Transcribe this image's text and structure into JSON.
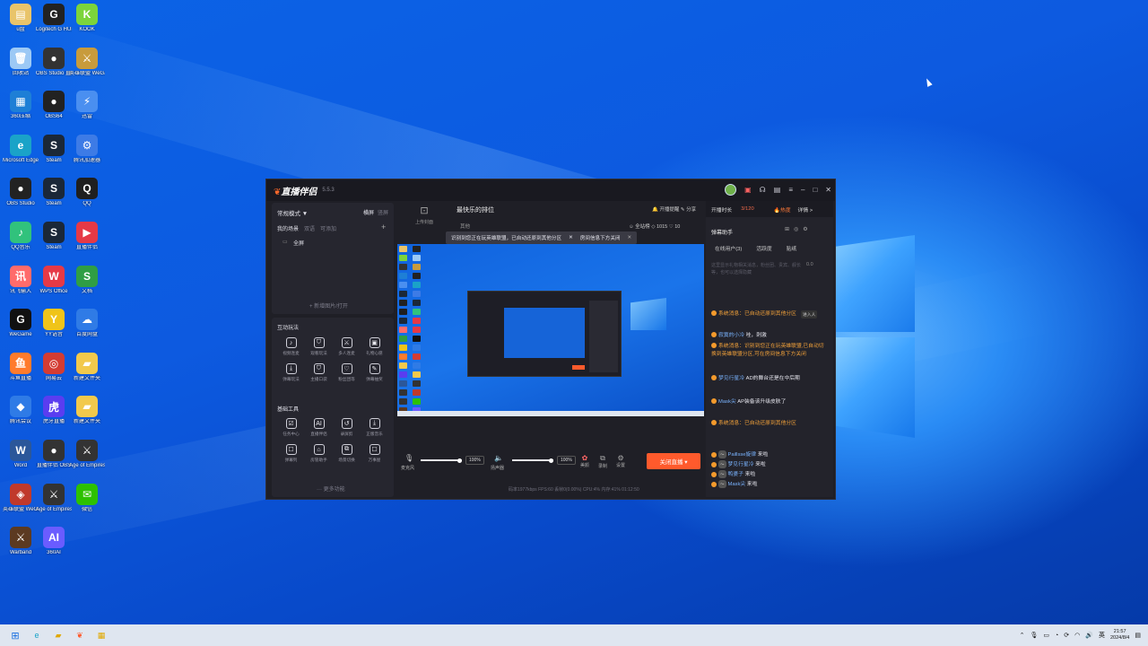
{
  "desktop_icons": [
    {
      "label": "u盘",
      "color": "#e9c46a",
      "glyph": "▤"
    },
    {
      "label": "Logitech G HUB",
      "color": "#222",
      "glyph": "G"
    },
    {
      "label": "KOOK",
      "color": "#7cd43b",
      "glyph": "K"
    },
    {
      "label": "回收站",
      "color": "#9cc9f5",
      "glyph": "🗑"
    },
    {
      "label": "OBS Studio 直播伴侣",
      "color": "#333",
      "glyph": "●"
    },
    {
      "label": "英雄联盟 WeGame版",
      "color": "#c89b3c",
      "glyph": "⚔"
    },
    {
      "label": "360压缩",
      "color": "#1e7fd6",
      "glyph": "▦"
    },
    {
      "label": "OBS64",
      "color": "#222",
      "glyph": "●"
    },
    {
      "label": "迅雷",
      "color": "#4a8ff0",
      "glyph": "⚡"
    },
    {
      "label": "Microsoft Edge",
      "color": "#1aa3c8",
      "glyph": "e"
    },
    {
      "label": "Steam",
      "color": "#1b2838",
      "glyph": "S"
    },
    {
      "label": "腾讯加速器",
      "color": "#3d7be6",
      "glyph": "⚙"
    },
    {
      "label": "OBS Studio",
      "color": "#222",
      "glyph": "●"
    },
    {
      "label": "Steam",
      "color": "#1b2838",
      "glyph": "S"
    },
    {
      "label": "QQ",
      "color": "#1f1f1f",
      "glyph": "Q"
    },
    {
      "label": "QQ音乐",
      "color": "#31c27c",
      "glyph": "♪"
    },
    {
      "label": "Steam",
      "color": "#1b2838",
      "glyph": "S"
    },
    {
      "label": "直播伴侣",
      "color": "#e63946",
      "glyph": "▶"
    },
    {
      "label": "讯飞输入",
      "color": "#ff6b6b",
      "glyph": "讯"
    },
    {
      "label": "WPS Office",
      "color": "#e63946",
      "glyph": "W"
    },
    {
      "label": "文档",
      "color": "#2f9e44",
      "glyph": "S"
    },
    {
      "label": "WeGame",
      "color": "#111",
      "glyph": "G"
    },
    {
      "label": "YY语音",
      "color": "#f0c419",
      "glyph": "Y"
    },
    {
      "label": "百度网盘",
      "color": "#2f7be6",
      "glyph": "☁"
    },
    {
      "label": "斗鱼直播",
      "color": "#ff7b2c",
      "glyph": "鱼"
    },
    {
      "label": "网易云",
      "color": "#d43c33",
      "glyph": "◎"
    },
    {
      "label": "新建文件夹",
      "color": "#f2c94c",
      "glyph": "▰"
    },
    {
      "label": "腾讯会议",
      "color": "#2f7be6",
      "glyph": "◆"
    },
    {
      "label": "虎牙直播",
      "color": "#5a3df0",
      "glyph": "虎"
    },
    {
      "label": "新建文件夹",
      "color": "#f2c94c",
      "glyph": "▰"
    },
    {
      "label": "Word",
      "color": "#2b579a",
      "glyph": "W"
    },
    {
      "label": "直播伴侣 OBS",
      "color": "#333",
      "glyph": "●"
    },
    {
      "label": "Age of Empires",
      "color": "#333",
      "glyph": "⚔"
    },
    {
      "label": "英雄联盟 WeGame版",
      "color": "#c0392b",
      "glyph": "◈"
    },
    {
      "label": "Age of Empires",
      "color": "#333",
      "glyph": "⚔"
    },
    {
      "label": "微信",
      "color": "#2dc100",
      "glyph": "✉"
    },
    {
      "label": "Warband",
      "color": "#5c3a21",
      "glyph": "⚔"
    },
    {
      "label": "360AI",
      "color": "#6a5cff",
      "glyph": "AI"
    }
  ],
  "app": {
    "logo_brand": "直播伴侣",
    "version": "5.5.3",
    "title_buttons": [
      "开播提醒",
      "分享"
    ],
    "left": {
      "mode_label": "常规模式 ▼",
      "mode_opts": [
        "横屏",
        "竖屏"
      ],
      "scene_tabs": [
        "我的场景",
        "双语",
        "可添加"
      ],
      "scene_item": "全屏",
      "add_scene": "+ 新增图片/打开",
      "section_interactive": "互动玩法",
      "interactive": [
        {
          "icon": "mic-icon",
          "glyph": "♪",
          "label": "视频连麦"
        },
        {
          "icon": "shield-icon",
          "glyph": "⛉",
          "label": "观看玩法"
        },
        {
          "icon": "swords-icon",
          "glyph": "⚔",
          "label": "多人连麦"
        },
        {
          "icon": "box-icon",
          "glyph": "▣",
          "label": "礼物心愿"
        },
        {
          "icon": "download-icon",
          "glyph": "⤓",
          "label": "弹幕玩法"
        },
        {
          "icon": "shield2-icon",
          "glyph": "⛉",
          "label": "主播口袋"
        },
        {
          "icon": "heart-icon",
          "glyph": "♡",
          "label": "粉丝团等"
        },
        {
          "icon": "edit-icon",
          "glyph": "✎",
          "label": "弹幕抽奖"
        }
      ],
      "section_tools": "基础工具",
      "tools": [
        {
          "icon": "task-icon",
          "glyph": "☑",
          "label": "任务中心"
        },
        {
          "icon": "ai-icon",
          "glyph": "AI",
          "label": "直播伴侣"
        },
        {
          "icon": "replay-icon",
          "glyph": "↺",
          "label": "录屏剪"
        },
        {
          "icon": "download2-icon",
          "glyph": "⤓",
          "label": "正版音乐"
        },
        {
          "icon": "bullet-icon",
          "glyph": "☐",
          "label": "弹幕列"
        },
        {
          "icon": "helper-icon",
          "glyph": "⌂",
          "label": "房管助手"
        },
        {
          "icon": "switch-icon",
          "glyph": "⧉",
          "label": "场景切换"
        },
        {
          "icon": "more-icon",
          "glyph": "☐",
          "label": "万事屋"
        }
      ],
      "more_label": "··· 更多功能"
    },
    "center": {
      "upload_cover": "上传封面",
      "stream_title": "最快乐的排位",
      "category": "其他",
      "toast_text": "识别到您正在玩英雄联盟，已自动还原到其他分区",
      "toast_action": "房间信息下方关闭",
      "followers": "全站榜",
      "count_a": "1015",
      "count_b": "10",
      "mic_label": "麦克风",
      "mic_pct": "100%",
      "mic_level": 0.95,
      "speaker_label": "扬声器",
      "speaker_pct": "100%",
      "speaker_level": 0.95,
      "btn_effects": "美颜",
      "btn_record": "录制",
      "btn_settings": "设置",
      "live_button": "关闭直播 ▾",
      "status": "码率1977kbps  FPS:60  丢帧0(0.00%)  CPU:4%  内存:41%  01:12:50"
    },
    "right": {
      "live_time_label": "开播时长",
      "live_count": "3/120",
      "pk_label": "热度",
      "detail_link": "详情 >",
      "helper_title": "弹幕助手",
      "tabs": [
        "在线用户(3)",
        "活跃度",
        "贴纸"
      ],
      "notice": "这里显示礼物相关消息，粉丝团、贵宾、舰长等，也可以选择隐藏",
      "notice_count": "0.0",
      "messages": [
        {
          "type": "sys",
          "text": "系统消息：已自动还原到其他分区"
        },
        {
          "type": "user",
          "name": "寂寞的小冷",
          "text": "哇，刺激"
        },
        {
          "type": "sys",
          "text": "系统消息：识别到您正在玩英雄联盟,已自动切换到英雄联盟分区,可在房间信息下方关闭"
        },
        {
          "type": "user",
          "name": "梦见行星冷",
          "text": "AD的舞台还是在中后期"
        },
        {
          "type": "user",
          "name": "Mask尖",
          "text": "AP装备该升级皮肤了"
        },
        {
          "type": "sys",
          "text": "系统消息：已自动还原到其他分区"
        }
      ],
      "joins": [
        {
          "name": "Paillsse旋律",
          "text": "来啦"
        },
        {
          "name": "梦见行星冷",
          "text": "来啦"
        },
        {
          "name": "鸭婆子",
          "text": "来啦"
        },
        {
          "name": "Mask尖",
          "text": "来啦"
        }
      ],
      "online_badge": "进入人"
    }
  },
  "taskbar": {
    "time": "21:57",
    "date": "2024/8/4",
    "ime": "英"
  }
}
